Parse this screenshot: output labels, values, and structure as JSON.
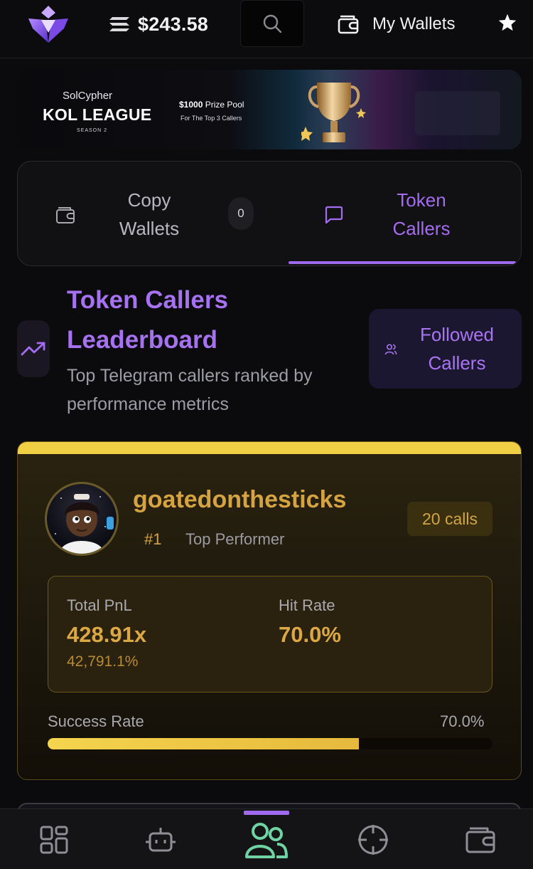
{
  "header": {
    "balance": "$243.58",
    "wallets_label": "My Wallets"
  },
  "banner": {
    "brand": "SolCypher",
    "title": "KOL LEAGUE",
    "season": "SEASON 2",
    "prize_amount": "$1000",
    "prize_text": "Prize Pool",
    "prize_sub": "For The Top 3 Callers"
  },
  "tabs": {
    "copy_wallets": {
      "label": "Copy Wallets",
      "count": "0"
    },
    "token_callers": {
      "label": "Token Callers"
    }
  },
  "leaderboard": {
    "title": "Token Callers Leaderboard",
    "subtitle": "Top Telegram callers ranked by performance metrics",
    "followed_button": "Followed Callers"
  },
  "caller": {
    "name": "goatedonthesticks",
    "rank": "#1",
    "tag": "Top Performer",
    "calls": "20 calls",
    "total_pnl_label": "Total PnL",
    "total_pnl": "428.91x",
    "total_pnl_pct": "42,791.1%",
    "hit_rate_label": "Hit Rate",
    "hit_rate": "70.0%",
    "success_rate_label": "Success Rate",
    "success_rate": "70.0%",
    "success_rate_fraction": 0.7
  },
  "colors": {
    "accent": "#9f6af0",
    "gold": "#f0cf45",
    "gold_text": "#d6a341",
    "nav_active": "#6fd3a3"
  },
  "icons": {
    "logo": "solcypher-logo-icon",
    "sol": "solana-icon",
    "search": "search-icon",
    "wallet": "wallet-icon",
    "star": "star-icon",
    "chat": "chat-icon",
    "trend": "trending-up-icon",
    "users": "users-icon",
    "nav": [
      "dashboard-icon",
      "bot-icon",
      "users-icon",
      "crosshair-icon",
      "wallet-icon"
    ]
  }
}
